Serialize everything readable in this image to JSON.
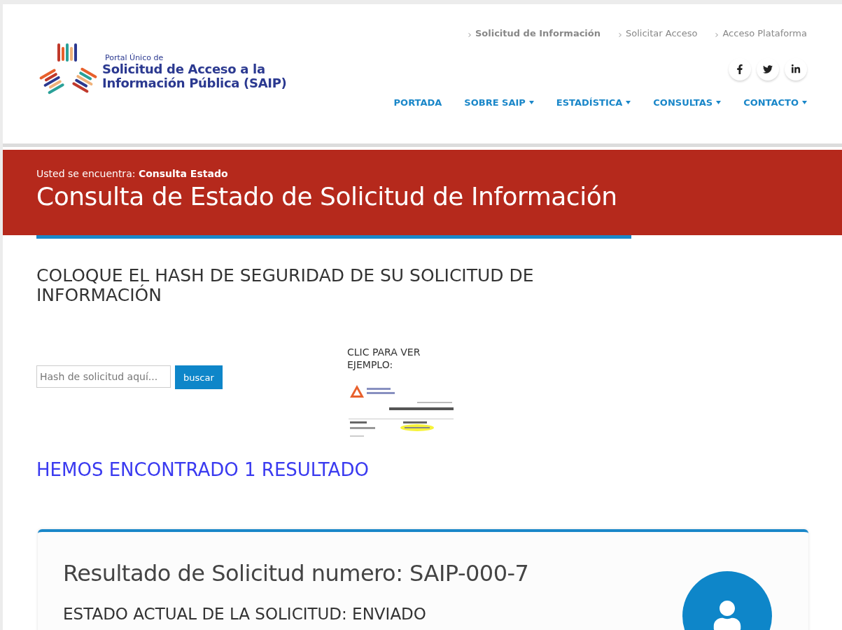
{
  "logo": {
    "tagline": "Portal Único de",
    "title_line_1": "Solicitud de Acceso a la",
    "title_line_2": "Información Pública (SAIP)"
  },
  "top_links": [
    {
      "label": "Solicitud de Información",
      "selected": true
    },
    {
      "label": "Solicitar Acceso",
      "selected": false
    },
    {
      "label": "Acceso Plataforma",
      "selected": false
    }
  ],
  "social": [
    {
      "kind": "facebook"
    },
    {
      "kind": "twitter"
    },
    {
      "kind": "linkedin"
    }
  ],
  "nav": [
    {
      "label": "PORTADA",
      "dropdown": false
    },
    {
      "label": "SOBRE SAIP",
      "dropdown": true
    },
    {
      "label": "ESTADÍSTICA",
      "dropdown": true
    },
    {
      "label": "CONSULTAS",
      "dropdown": true
    },
    {
      "label": "CONTACTO",
      "dropdown": true
    }
  ],
  "banner": {
    "breadcrumb_prefix": "Usted se encuentra:",
    "breadcrumb_current": "Consulta Estado",
    "title": "Consulta de Estado de Solicitud de Información"
  },
  "search_section": {
    "heading": "COLOQUE EL HASH DE SEGURIDAD DE SU SOLICITUD DE INFORMACIÓN",
    "field": {
      "placeholder": "Hash de solicitud aquí..."
    },
    "button": "buscar",
    "example_label": "CLIC PARA VER EJEMPLO:"
  },
  "results_heading": "HEMOS ENCONTRADO 1 RESULTADO",
  "result_card": {
    "title": "Resultado de Solicitud numero: SAIP-000-7",
    "status": "ESTADO ACTUAL DE LA SOLICITUD: ENVIADO"
  }
}
